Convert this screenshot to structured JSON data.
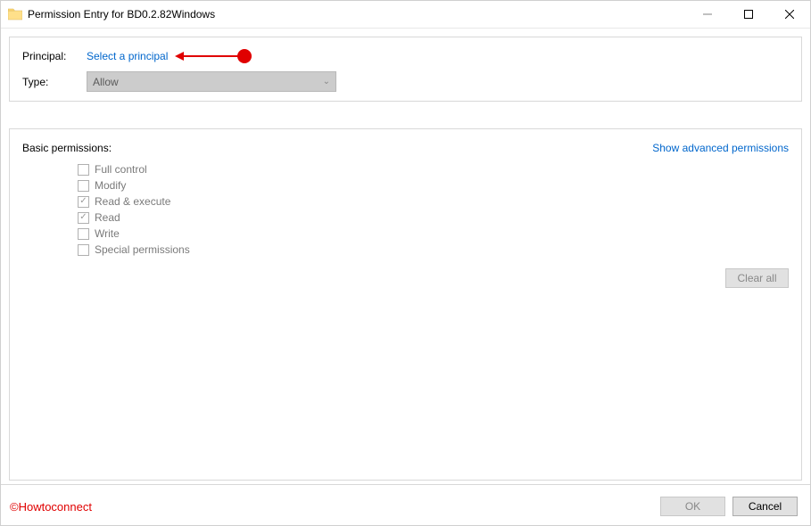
{
  "window": {
    "title": "Permission Entry for BD0.2.82Windows"
  },
  "top": {
    "principal_label": "Principal:",
    "principal_link": "Select a principal",
    "type_label": "Type:",
    "type_value": "Allow"
  },
  "perms": {
    "heading": "Basic permissions:",
    "advanced_link": "Show advanced permissions",
    "items": [
      {
        "label": "Full control",
        "checked": false
      },
      {
        "label": "Modify",
        "checked": false
      },
      {
        "label": "Read & execute",
        "checked": true
      },
      {
        "label": "Read",
        "checked": true
      },
      {
        "label": "Write",
        "checked": false
      },
      {
        "label": "Special permissions",
        "checked": false
      }
    ],
    "clear_all": "Clear all"
  },
  "footer": {
    "watermark": "©Howtoconnect",
    "ok": "OK",
    "cancel": "Cancel"
  }
}
